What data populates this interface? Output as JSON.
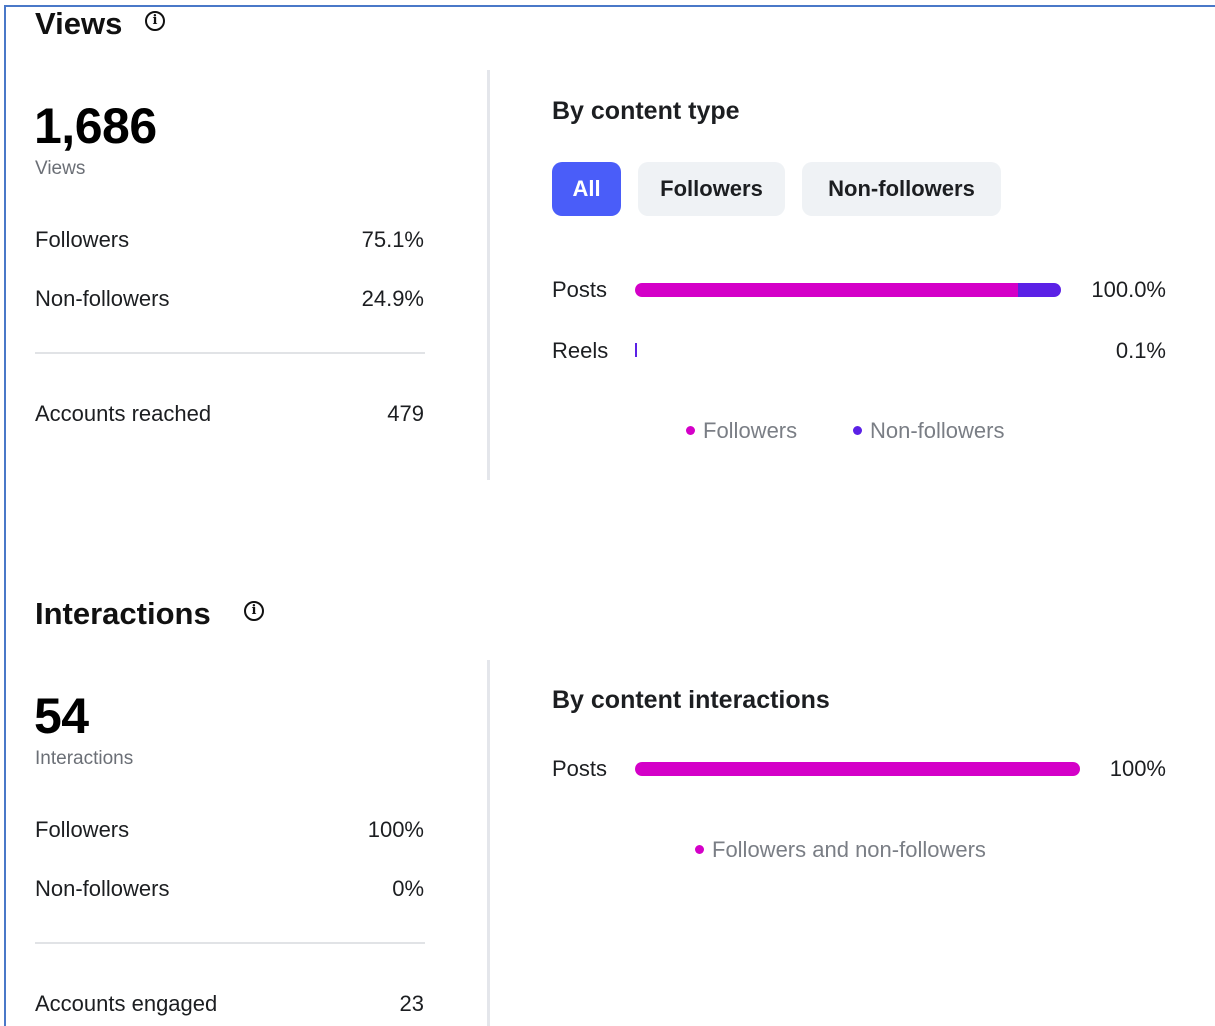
{
  "colors": {
    "followers": "#d400c8",
    "non_followers": "#5b21e6",
    "accent": "#4a5df9"
  },
  "views": {
    "title": "Views",
    "info_icon": "info-circle-icon",
    "total": "1,686",
    "total_label": "Views",
    "rows": [
      {
        "label": "Followers",
        "value": "75.1%"
      },
      {
        "label": "Non-followers",
        "value": "24.9%"
      }
    ],
    "reached_label": "Accounts reached",
    "reached_value": "479",
    "breakdown": {
      "heading": "By content type",
      "filters": [
        {
          "label": "All",
          "active": true
        },
        {
          "label": "Followers",
          "active": false
        },
        {
          "label": "Non-followers",
          "active": false
        }
      ],
      "bars": [
        {
          "label": "Posts",
          "value": "100.0%",
          "share": 1.0,
          "followers_fraction": 0.9
        },
        {
          "label": "Reels",
          "value": "0.1%",
          "share": 0.001,
          "followers_fraction": 0.0
        }
      ],
      "legend": [
        "Followers",
        "Non-followers"
      ]
    }
  },
  "interactions": {
    "title": "Interactions",
    "info_icon": "info-circle-icon",
    "total": "54",
    "total_label": "Interactions",
    "rows": [
      {
        "label": "Followers",
        "value": "100%"
      },
      {
        "label": "Non-followers",
        "value": "0%"
      }
    ],
    "engaged_label": "Accounts engaged",
    "engaged_value": "23",
    "breakdown": {
      "heading": "By content interactions",
      "bars": [
        {
          "label": "Posts",
          "value": "100%",
          "share": 1.0
        }
      ],
      "legend": [
        "Followers and non-followers"
      ]
    }
  }
}
